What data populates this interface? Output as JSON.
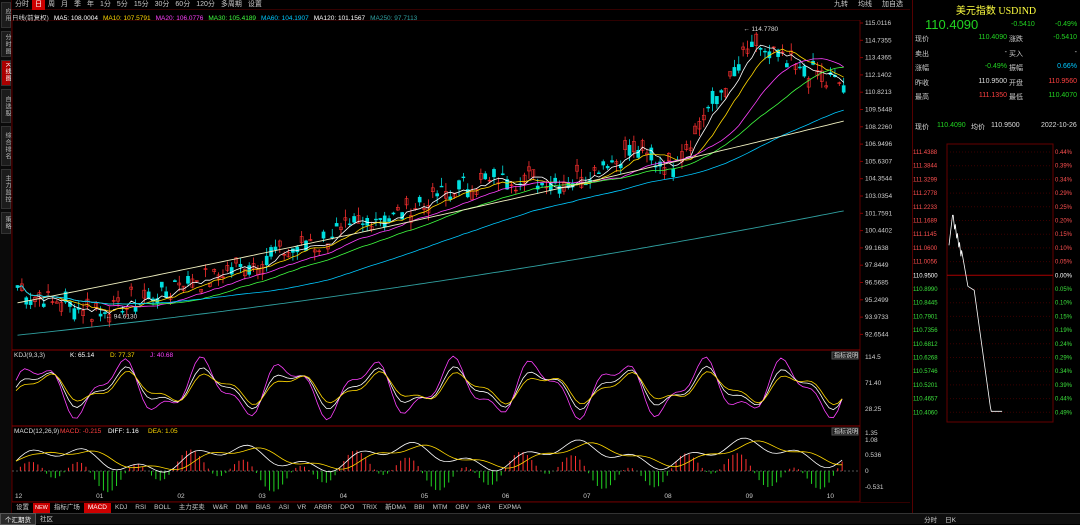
{
  "left_tabs": [
    "应用",
    "分时图",
    "K线图",
    "自选股",
    "综合排名",
    "主力监控",
    "策略"
  ],
  "top_tabs": [
    "分时",
    "日",
    "周",
    "月",
    "季",
    "年",
    "1分",
    "5分",
    "15分",
    "30分",
    "60分",
    "120分",
    "多周期",
    "设置"
  ],
  "top_right": [
    "九转",
    "均线",
    "加自选"
  ],
  "ma_legend": {
    "title": "日线(前复权)",
    "items": [
      {
        "label": "MA5: 108.0004",
        "color": "#ffffff"
      },
      {
        "label": "MA10: 107.5791",
        "color": "#ffd700"
      },
      {
        "label": "MA20: 106.0776",
        "color": "#ff40ff"
      },
      {
        "label": "MA30: 105.4189",
        "color": "#40ff40"
      },
      {
        "label": "MA60: 104.1907",
        "color": "#00c8ff"
      },
      {
        "label": "MA120: 101.1567",
        "color": "#ffffff"
      },
      {
        "label": "MA250: 97.7113",
        "color": "#30a0a0"
      }
    ]
  },
  "main_axis_labels": [
    "115.0116",
    "114.7355",
    "113.4365",
    "112.1402",
    "110.8213",
    "109.5448",
    "108.2260",
    "106.9496",
    "105.6307",
    "104.3544",
    "103.0354",
    "101.7591",
    "100.4402",
    "99.1638",
    "97.8449",
    "96.5685",
    "95.2499",
    "93.9733",
    "92.6544"
  ],
  "annotations": {
    "high": "114.7780",
    "low": "94.6130"
  },
  "x_labels": [
    "12",
    "01",
    "02",
    "03",
    "04",
    "05",
    "06",
    "07",
    "08",
    "09",
    "10"
  ],
  "kdj": {
    "label": "KDJ(9,3,3)",
    "k": "K: 65.14",
    "d": "D: 77.37",
    "j": "J: 40.68",
    "axis": [
      "114.5",
      "71.40",
      "28.25"
    ],
    "button": "指标说明"
  },
  "macd": {
    "label": "MACD(12,26,9)",
    "macd": "MACD: -0.215",
    "diff": "DIFF: 1.16",
    "dea": "DEA: 1.05",
    "axis": [
      "1.35",
      "1.08",
      "0.536",
      "0",
      "-0.531"
    ],
    "button": "指标说明"
  },
  "bottom_tabs": [
    "设置",
    "指标广场",
    "MACD",
    "KDJ",
    "RSI",
    "BOLL",
    "主力买卖",
    "W&R",
    "DMI",
    "BIAS",
    "ASI",
    "VR",
    "ARBR",
    "DPO",
    "TRIX",
    "新DMA",
    "BBI",
    "MTM",
    "OBV",
    "SAR",
    "EXPMA"
  ],
  "new_badge": "NEW",
  "status_bar": [
    "个汇期货",
    "社区"
  ],
  "status_right": [
    "分时",
    "日K"
  ],
  "quote": {
    "title": "美元指数 USDIND",
    "price": "110.4090",
    "change": "-0.5410",
    "pct": "-0.49%",
    "rows": [
      {
        "k1": "现价",
        "v1": "110.4090",
        "c1": "green",
        "k2": "涨跌",
        "v2": "-0.5410",
        "c2": "green"
      },
      {
        "k1": "卖出",
        "v1": "-",
        "c1": "white",
        "k2": "买入",
        "v2": "-",
        "c2": "white"
      },
      {
        "k1": "涨幅",
        "v1": "-0.49%",
        "c1": "green",
        "k2": "振幅",
        "v2": "0.66%",
        "c2": "cyan"
      },
      {
        "k1": "昨收",
        "v1": "110.9500",
        "c1": "white",
        "k2": "开盘",
        "v2": "110.9560",
        "c2": "red"
      },
      {
        "k1": "最高",
        "v1": "111.1350",
        "c1": "red",
        "k2": "最低",
        "v2": "110.4070",
        "c2": "green"
      }
    ],
    "mini_header": {
      "k1": "现价",
      "v1": "110.4090",
      "k2": "均价",
      "v2": "110.9500",
      "date": "2022-10-26"
    },
    "mini_left": [
      "111.4388",
      "111.3844",
      "111.3299",
      "111.2778",
      "111.2233",
      "111.1689",
      "111.1145",
      "111.0600",
      "111.0056",
      "110.9500",
      "110.8990",
      "110.8445",
      "110.7901",
      "110.7356",
      "110.6812",
      "110.6268",
      "110.5746",
      "110.5201",
      "110.4657",
      "110.4060"
    ],
    "mini_right": [
      "0.44%",
      "0.39%",
      "0.34%",
      "0.29%",
      "0.25%",
      "0.20%",
      "0.15%",
      "0.10%",
      "0.05%",
      "0.00%",
      "0.05%",
      "0.10%",
      "0.15%",
      "0.19%",
      "0.24%",
      "0.29%",
      "0.34%",
      "0.39%",
      "0.44%",
      "0.49%"
    ]
  },
  "colors": {
    "up": "#ff3030",
    "down": "#00e0e0",
    "grid": "#5a0000",
    "bg": "#000000"
  }
}
